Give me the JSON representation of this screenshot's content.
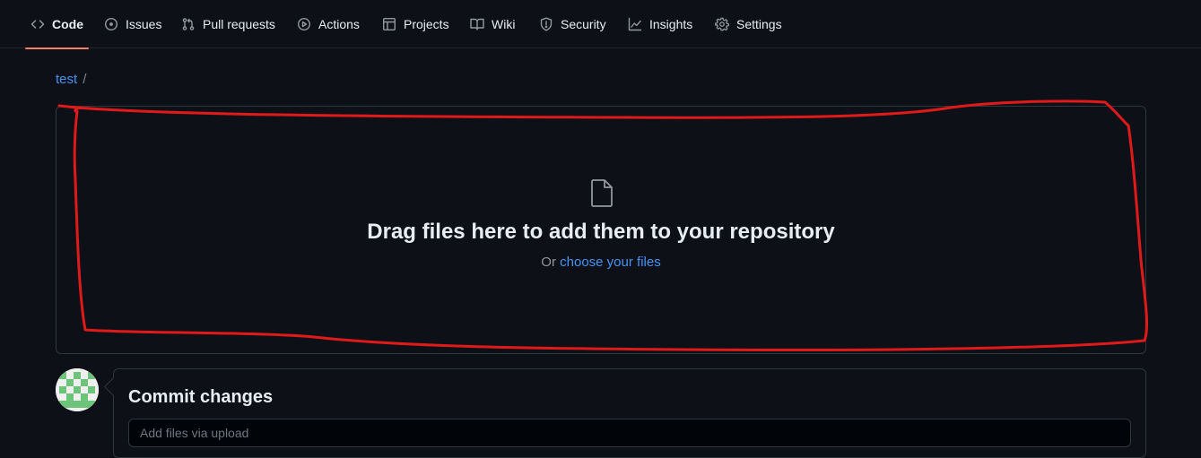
{
  "nav": {
    "tabs": [
      {
        "label": "Code",
        "icon": "code-icon",
        "selected": true
      },
      {
        "label": "Issues",
        "icon": "issue-opened-icon"
      },
      {
        "label": "Pull requests",
        "icon": "git-pull-request-icon"
      },
      {
        "label": "Actions",
        "icon": "play-icon"
      },
      {
        "label": "Projects",
        "icon": "table-icon"
      },
      {
        "label": "Wiki",
        "icon": "book-icon"
      },
      {
        "label": "Security",
        "icon": "shield-icon"
      },
      {
        "label": "Insights",
        "icon": "graph-icon"
      },
      {
        "label": "Settings",
        "icon": "gear-icon"
      }
    ]
  },
  "breadcrumb": {
    "repo": "test",
    "separator": "/"
  },
  "dropzone": {
    "icon": "file-icon",
    "title": "Drag files here to add them to your repository",
    "or_text": "Or",
    "choose_link": "choose your files"
  },
  "commit": {
    "title": "Commit changes",
    "input_placeholder": "Add files via upload"
  },
  "colors": {
    "background": "#0d1117",
    "accent_link": "#4493f8",
    "selected_tab_underline": "#f78166",
    "annotation": "#e0191b"
  }
}
